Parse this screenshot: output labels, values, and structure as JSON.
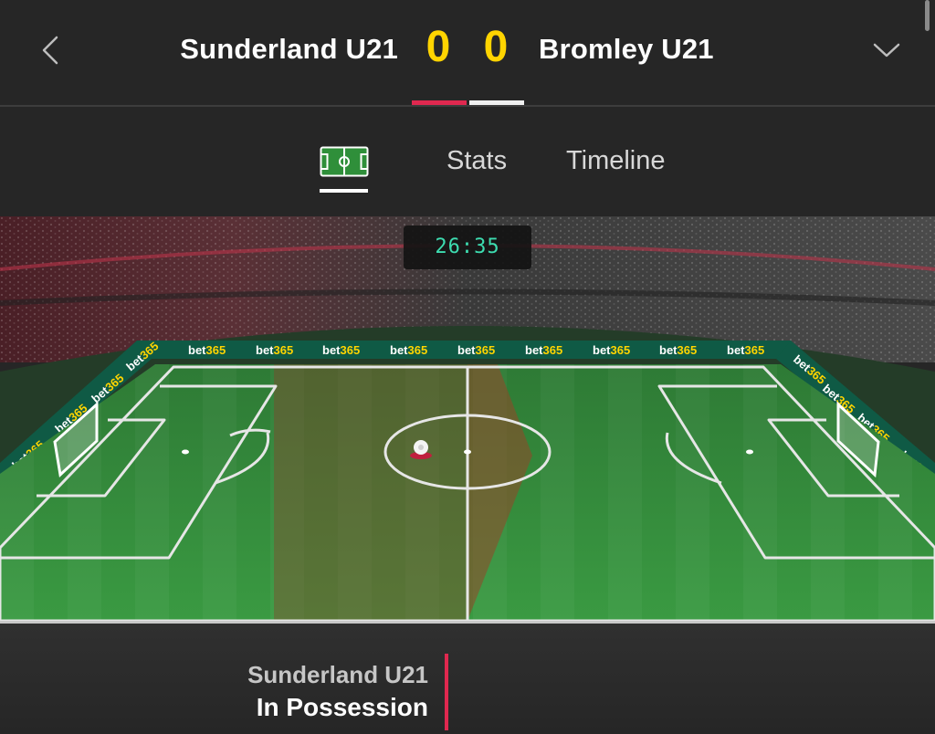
{
  "header": {
    "home_team": "Sunderland U21",
    "away_team": "Bromley U21",
    "home_score": "0",
    "away_score": "0",
    "score_color": "#ffd400",
    "home_color": "#e0284f",
    "away_color": "#f0f0f0"
  },
  "tabs": [
    {
      "label": "",
      "icon": "pitch-icon",
      "active": true
    },
    {
      "label": "Stats",
      "active": false
    },
    {
      "label": "Timeline",
      "active": false
    }
  ],
  "pitch": {
    "clock": "26:35",
    "sponsor": "bet365"
  },
  "possession": {
    "team": "Sunderland U21",
    "status": "In Possession"
  }
}
